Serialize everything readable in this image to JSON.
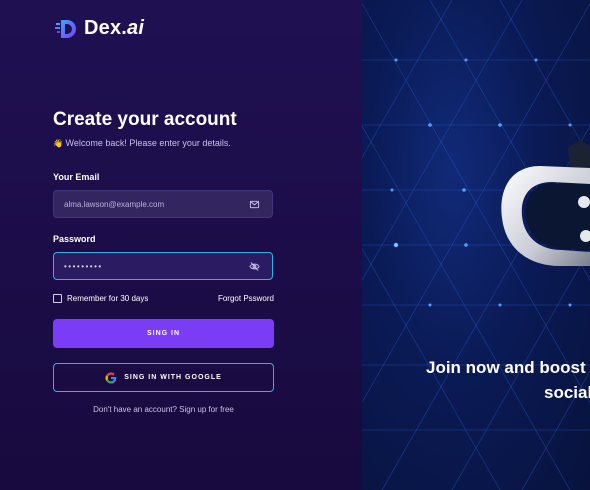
{
  "brand": {
    "name_main": "Dex.",
    "name_suffix": "ai"
  },
  "form": {
    "title": "Create your account",
    "subtitle_emoji": "👋",
    "subtitle": "Welcome back! Please enter your details.",
    "email_label": "Your Email",
    "email_value": "alma.lawson@example.com",
    "password_label": "Password",
    "password_value": "•••••••••",
    "remember_label": "Remember for 30 days",
    "forgot_label": "Forgot Pssword",
    "signin_label": "SING IN",
    "google_label": "SING IN WITH GOOGLE",
    "signup_text": "Don't have an account? Sign up for free"
  },
  "promo": {
    "headline_line1": "Join now and boost y",
    "headline_line2": "social"
  },
  "colors": {
    "left_bg": "#1c0d49",
    "right_bg": "#0a1a55",
    "primary_button": "#7a3cf5",
    "focus_border": "#2fb3e6"
  }
}
